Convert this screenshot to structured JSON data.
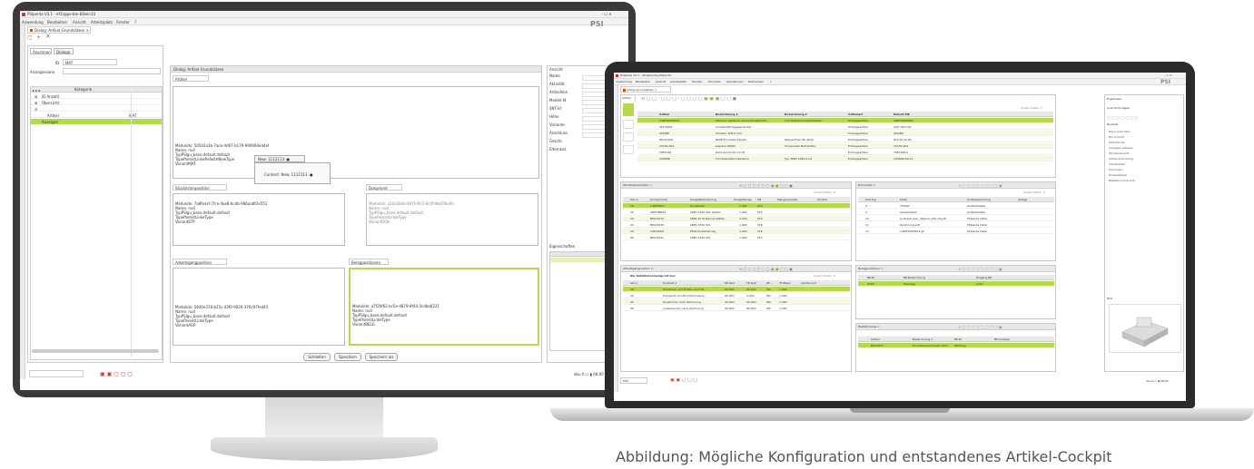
{
  "caption": "Abbildung: Mögliche Konfiguration und entstandenes Artikel-Cockpit",
  "colors": {
    "accent_green": "#b6d94c",
    "light_green": "#e3f0b9",
    "frame_dark": "#3a3a3c"
  },
  "desktop": {
    "title": "PSIpenta V3.1 - ef1l@pe-ble-EI8ein10",
    "menu": [
      "Anwendung",
      "Bearbeiten",
      "Ansicht",
      "Arbeitsplatz",
      "Fenster",
      "?"
    ],
    "logo": "PSI",
    "doc_tab": "Dialog: Artikel-Grundsätzen ×",
    "left_tabs": [
      "Anschnen",
      "Dialoge"
    ],
    "id_label": "ID",
    "id_value": "MAT",
    "anzeige_label": "Anzeigename",
    "tree_header": "Kategorie",
    "tree_items": [
      "ID Anzahl",
      "Übersicht",
      "Artikel",
      "Anzeigen"
    ],
    "tree_value": "MAT",
    "panel_title": "Dialog: Artikel-Grundsätzen",
    "artikel_label": "Artikel",
    "artikel_text": [
      "Modulidx: 50502a1b-7ace-4d07-b179-990660ed4ef",
      "Name: null",
      "TypPSlgu_base.default.default",
      "TypeParentLinkeRefwithNewType",
      "VariantMAT"
    ],
    "popup_title": "New: 1112113: ●",
    "popup_text": "Content: New: 1112113: ●",
    "stueck_label": "Stücklistenposition",
    "stueck_text": [
      "Modulidx: 7a8feacf-7fce-4ae8-bcdb-986aa8f2e551",
      "Name: null",
      "TypPSlgu_base.default.default",
      "TypeParentLinkeType",
      "VariantSTP"
    ],
    "doku_label": "Dokument",
    "doku_text": [
      "Modulidx: c22a2b0d-9d7f-4fc2-9c0f-9be5fba9a",
      "Name: null",
      "TypPSlgu_base.default.default",
      "TypeParentLinkeType",
      "VariantDOK"
    ],
    "arbeit_label": "Arbeitsgangposition",
    "arbeit_text": [
      "Modulidx: 5840e378-b25c-43f0-9026-376c97fed43",
      "Name: null",
      "TypPSlgu_base.default.default",
      "TypeParentLinkeType",
      "VariantAGP"
    ],
    "beleg_label": "Belegpositionen",
    "beleg_text": [
      "Modulidx: a7f26f62-bc5e-4879-8f44-3cdba6221",
      "Name: null",
      "TypPSlgu_base.default.default",
      "TypeParentLinkeType",
      "VariantBELG"
    ],
    "buttons": [
      "Schließen",
      "Speichern",
      "Speichern als"
    ],
    "right_props": [
      "Name",
      "Aktivität",
      "ArtikelVon",
      "Modell-Id",
      "SNT-Id",
      "Höhe",
      "Variante",
      "Anschluss",
      "Geschl.",
      "Elternkat."
    ],
    "right_panel": "Ansicht",
    "right_lower": "Eigenschaften",
    "status_right": "deu  A  ☐  ▮  08:00"
  },
  "laptop": {
    "title": "PSIpenta V3.1 - ef1l@pe-ble-EI8ein10",
    "menu": [
      "Anwendung",
      "Bearbeiten",
      "Ansicht",
      "Arbeitsplatz",
      "Fenster",
      "Favoriten",
      "Operationen",
      "Referenzen",
      "?"
    ],
    "logo": "PSI",
    "doc_tab": "Artikel-Grundsätzen ×",
    "artikel_tab": "Artikel",
    "artikel_cols": [
      "Artikel",
      "Bezeichnung 1",
      "Bezeichnung 2",
      "Artikelart",
      "Einheit ME"
    ],
    "artikel_rows": [
      [
        "1-BPF250M014",
        "Flansch, Gehäuse und Kontrolleinheit",
        "mit Variantenmöglichkeiten",
        "Eintragsartikel",
        "1BPF250M014"
      ],
      [
        "250-6R01",
        "Kunststoffentgegendeckel",
        "",
        "Eintragsartikel",
        "AUE 169-701"
      ],
      [
        "AMAB8",
        "Scheibe, DIN 6 mm",
        "",
        "Eintragsartikel",
        "AMAB8"
      ],
      [
        "BP231000",
        "BAPE-Formteile Modell",
        "Wasserfluss HD Stufe",
        "Eintragsartikel",
        "HLP-HI-22-8C"
      ],
      [
        "15182-002",
        "Gepäck 1080X",
        "Universelle Möbelhöhe",
        "Eintragsartikel",
        "15182-002"
      ],
      [
        "TP87226",
        "Zahnrad Z=20 m=16",
        "",
        "Eintragsartikel",
        "TP87226-0"
      ],
      [
        "C09888",
        "Formteilsatzkombination",
        "Typ 3880 1280-0-C0",
        "Eintragsartikel",
        "C09888-00-21"
      ]
    ],
    "stueck_panel": "Stücklistenposition ×",
    "stueck_cols": [
      "Pos.nr",
      "Komponente",
      "Kurzg/Bezeichnung",
      "Kurzg/Menge",
      "ME",
      "Mengeneinheit",
      "Art-Info"
    ],
    "stueck_rows": [
      [
        "10",
        "1-BPF2001",
        "Kundenfall",
        "1.000",
        "STK"
      ],
      [
        "20",
        "2BHOMN10",
        "LBPS 3300 001 Stellen",
        "1.000",
        "STK"
      ],
      [
        "30",
        "BPLS3070",
        "LBPS 25.5t Banner Platte",
        "2.000",
        "STK"
      ],
      [
        "40",
        "BPLS3045",
        "LBPS 3300 001",
        "1.000",
        "STK"
      ],
      [
        "50",
        "CW50009",
        "PFIW Endaktierung",
        "1.000",
        "STK"
      ],
      [
        "60",
        "BPLS3041",
        "LBPS 3300 001",
        "1.000",
        "STK"
      ]
    ],
    "doku_panel": "Dokument ×",
    "doku_cols": [
      "Dok.Typ",
      "Datei",
      "Kurzbezeichnung",
      "Ablage"
    ],
    "doku_rows": [
      [
        "3",
        "78-Text",
        "Kurztextdatei"
      ],
      [
        "5",
        "Verkaufstext",
        "Kurztextdatei"
      ],
      [
        "10",
        "protokoll_bau_datenre_001.V3.pdf",
        "PSIpenta Datei"
      ],
      [
        "11",
        "Zeichnung.pdf",
        "PSIpenta Datei"
      ],
      [
        "13",
        "1-BPF250M014.gif",
        "PSIpenta Datei"
      ]
    ],
    "arbeit_panel": "Arbeitsgangposition ×",
    "arbeit_filter": "Die Satzbinnenmenge ist leer",
    "arbeit_cols": [
      "AG-nr",
      "Kurztext 1",
      "RE-Zeit",
      "TE-Zeit",
      "ZE...",
      "TE-Basis",
      "AG-Men-Art"
    ],
    "arbeit_rows": [
      [
        "10",
        "Montieren und Prüfen nach Vo...",
        "60,000",
        "60,000",
        "Min",
        "1.000"
      ],
      [
        "20",
        "Transport von Montierennema...",
        "60,000",
        "0,000",
        "Min",
        "1.000"
      ],
      [
        "30",
        "Zusammen nach Zeichnung",
        "90,000",
        "60,000",
        "Min",
        "1.000"
      ],
      [
        "40",
        "Ausbenenren nach Zeichnung",
        "90,000",
        "60,000",
        "Min",
        "1.000"
      ]
    ],
    "beleg_panel": "Belegpositionen ×",
    "beleg_cols": [
      "BE-Nr",
      "BE-Bezeichnung",
      "Eingang BE"
    ],
    "beleg_rows": [
      [
        "0400",
        "Montage",
        "extrn"
      ]
    ],
    "bestell_panel": "Bestellmenge ×",
    "bestell_cols": [
      "Artikel",
      "Bezeichnung 1",
      "BE-Nr",
      "BE-Anzeige"
    ],
    "bestell_rows": [
      [
        "BAH1877",
        "Durchsteckschraube 1877",
        "Wartung"
      ]
    ],
    "right_sections": [
      "Ergebnisse",
      "Ansicht-Vorlagen",
      "Bauteile"
    ],
    "right_items": [
      "Neue Ansichten",
      "Zur Ansicht",
      "Definitionen",
      "Anzeigen anlegen",
      "Stücklistenaufl.",
      "Artikel-Zuordnung",
      "Arbeitsplatz",
      "Dokument",
      "Prozessfelder",
      "Bestellnummeraufl."
    ],
    "right_preview": "Bild",
    "status_left": "MAT",
    "status_right": "deu  A  ☐  ▮  08:00",
    "anzahl_label": "Anzahl Daten: 4"
  }
}
